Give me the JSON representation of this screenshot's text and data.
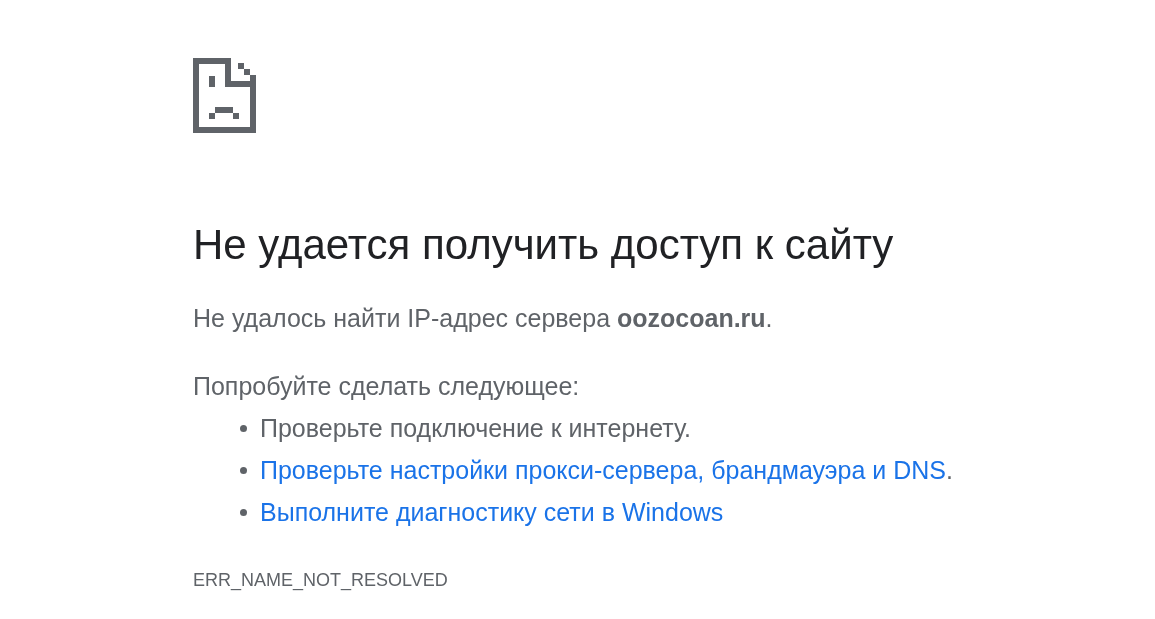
{
  "heading": "Не удается получить доступ к сайту",
  "summary": "Не удалось найти IP-адрес сервера **oozocoan.ru**.",
  "suggestions_title": "Попробуйте сделать следующее:",
  "suggestions": [
    {
      "kind": "text",
      "text": "Проверьте подключение к интернету."
    },
    {
      "kind": "link",
      "text": "Проверьте настройки прокси-сервера, брандмауэра и DNS",
      "suffix": "."
    },
    {
      "kind": "link",
      "text": "Выполните диагностику сети в Windows"
    }
  ],
  "error_code": "ERR_NAME_NOT_RESOLVED"
}
